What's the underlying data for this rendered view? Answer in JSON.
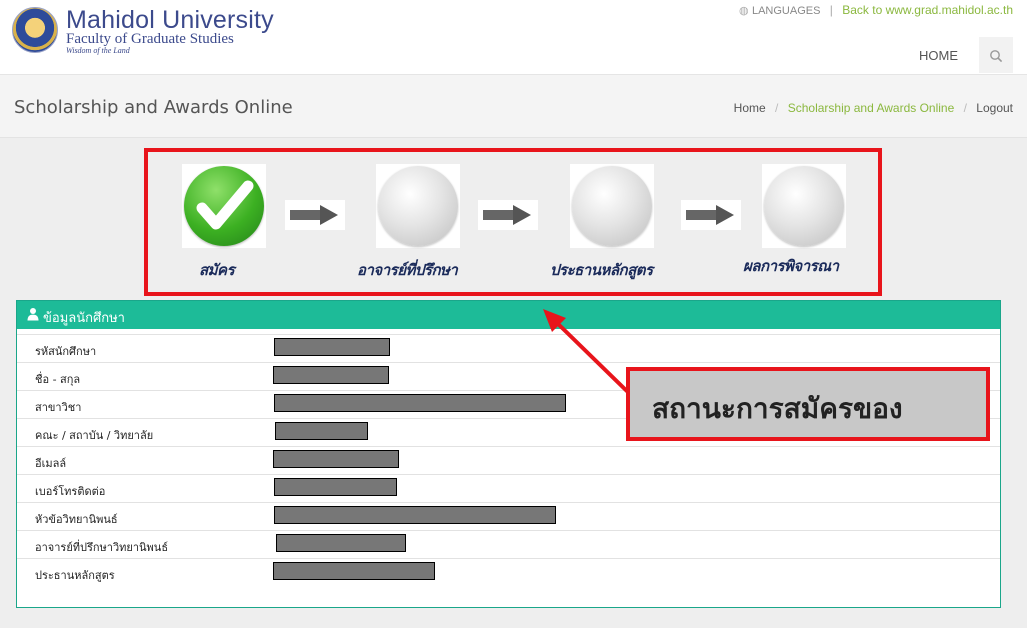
{
  "header": {
    "university": "Mahidol University",
    "faculty": "Faculty of Graduate Studies",
    "motto": "Wisdom of the Land",
    "languages": "LANGUAGES",
    "separator": "|",
    "back_link": "Back to www.grad.mahidol.ac.th",
    "nav_home": "HOME"
  },
  "page": {
    "title": "Scholarship and Awards Online",
    "breadcrumb": [
      "Home",
      "Scholarship and Awards Online",
      "Logout"
    ],
    "breadcrumb_sep": "/"
  },
  "steps": [
    {
      "label": "สมัคร",
      "status": "complete"
    },
    {
      "label": "อาจารย์ที่ปรึกษา",
      "status": "pending"
    },
    {
      "label": "ประธานหลักสูตร",
      "status": "pending"
    },
    {
      "label": "ผลการพิจารณา",
      "status": "pending"
    }
  ],
  "panel": {
    "title": "ข้อมูลนักศึกษา",
    "rows": [
      {
        "label": "รหัสนักศึกษา"
      },
      {
        "label": "ชื่อ - สกุล"
      },
      {
        "label": "สาขาวิชา"
      },
      {
        "label": "คณะ / สถาบัน / วิทยาลัย"
      },
      {
        "label": "อีเมลล์"
      },
      {
        "label": "เบอร์โทรติดต่อ"
      },
      {
        "label": "หัวข้อวิทยานิพนธ์"
      },
      {
        "label": "อาจารย์ที่ปรึกษาวิทยานิพนธ์"
      },
      {
        "label": "ประธานหลักสูตร"
      }
    ]
  },
  "annotation": {
    "callout_text": "สถานะการสมัครของ"
  },
  "colors": {
    "accent_green": "#1dbb98",
    "link_green": "#8bb83f",
    "highlight_red": "#e8141b",
    "brand_blue": "#3c4a8c"
  }
}
